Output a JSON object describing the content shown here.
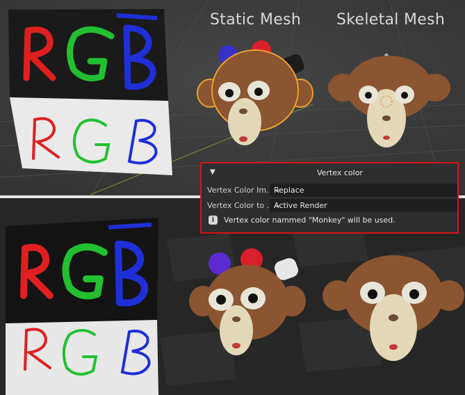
{
  "captions": {
    "static_mesh": "Static Mesh",
    "skeletal_mesh": "Skeletal Mesh"
  },
  "rgb_texture": {
    "top_letters": "RGB",
    "bottom_letters": "RGB"
  },
  "panel": {
    "title": "Vertex color",
    "rows": [
      {
        "label": "Vertex Color Im...",
        "value": "Replace"
      },
      {
        "label": "Vertex Color to ...",
        "value": "Active Render"
      }
    ],
    "info_icon": "info-icon",
    "info_text": "Vertex color nammed \"Monkey\" will be used."
  },
  "colors": {
    "red": "#e02020",
    "green": "#22c030",
    "blue": "#1f2fd8",
    "highlight_border": "#d8121b",
    "selection_outline": "#f0a030"
  }
}
